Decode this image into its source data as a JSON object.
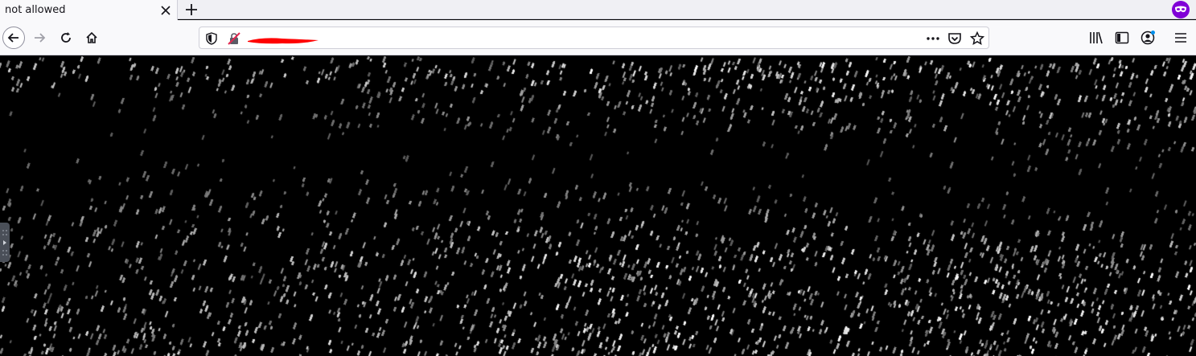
{
  "tab": {
    "title": "not allowed"
  },
  "icons": {
    "close_tab": "close-icon",
    "new_tab": "plus-icon",
    "private": "private-browsing-mask-icon",
    "back": "back-arrow-icon",
    "forward": "forward-arrow-icon",
    "reload": "reload-icon",
    "home": "home-icon",
    "shield": "tracking-protection-shield-icon",
    "insecure": "insecure-lock-icon",
    "more": "page-actions-ellipsis-icon",
    "pocket": "pocket-icon",
    "bookmark": "bookmark-star-icon",
    "library": "library-icon",
    "sidebar": "sidebar-icon",
    "account": "account-icon",
    "menu": "hamburger-menu-icon"
  },
  "urlbar": {
    "redacted": true,
    "redaction_color": "#ff0000"
  },
  "colors": {
    "tabstrip": "#f0f0f4",
    "toolbar": "#f9f9fb",
    "private_accent": "#8000d7",
    "content_bg": "#000000",
    "account_badge": "#0090ed"
  },
  "content": {
    "description_type": "dark-noise-image"
  }
}
